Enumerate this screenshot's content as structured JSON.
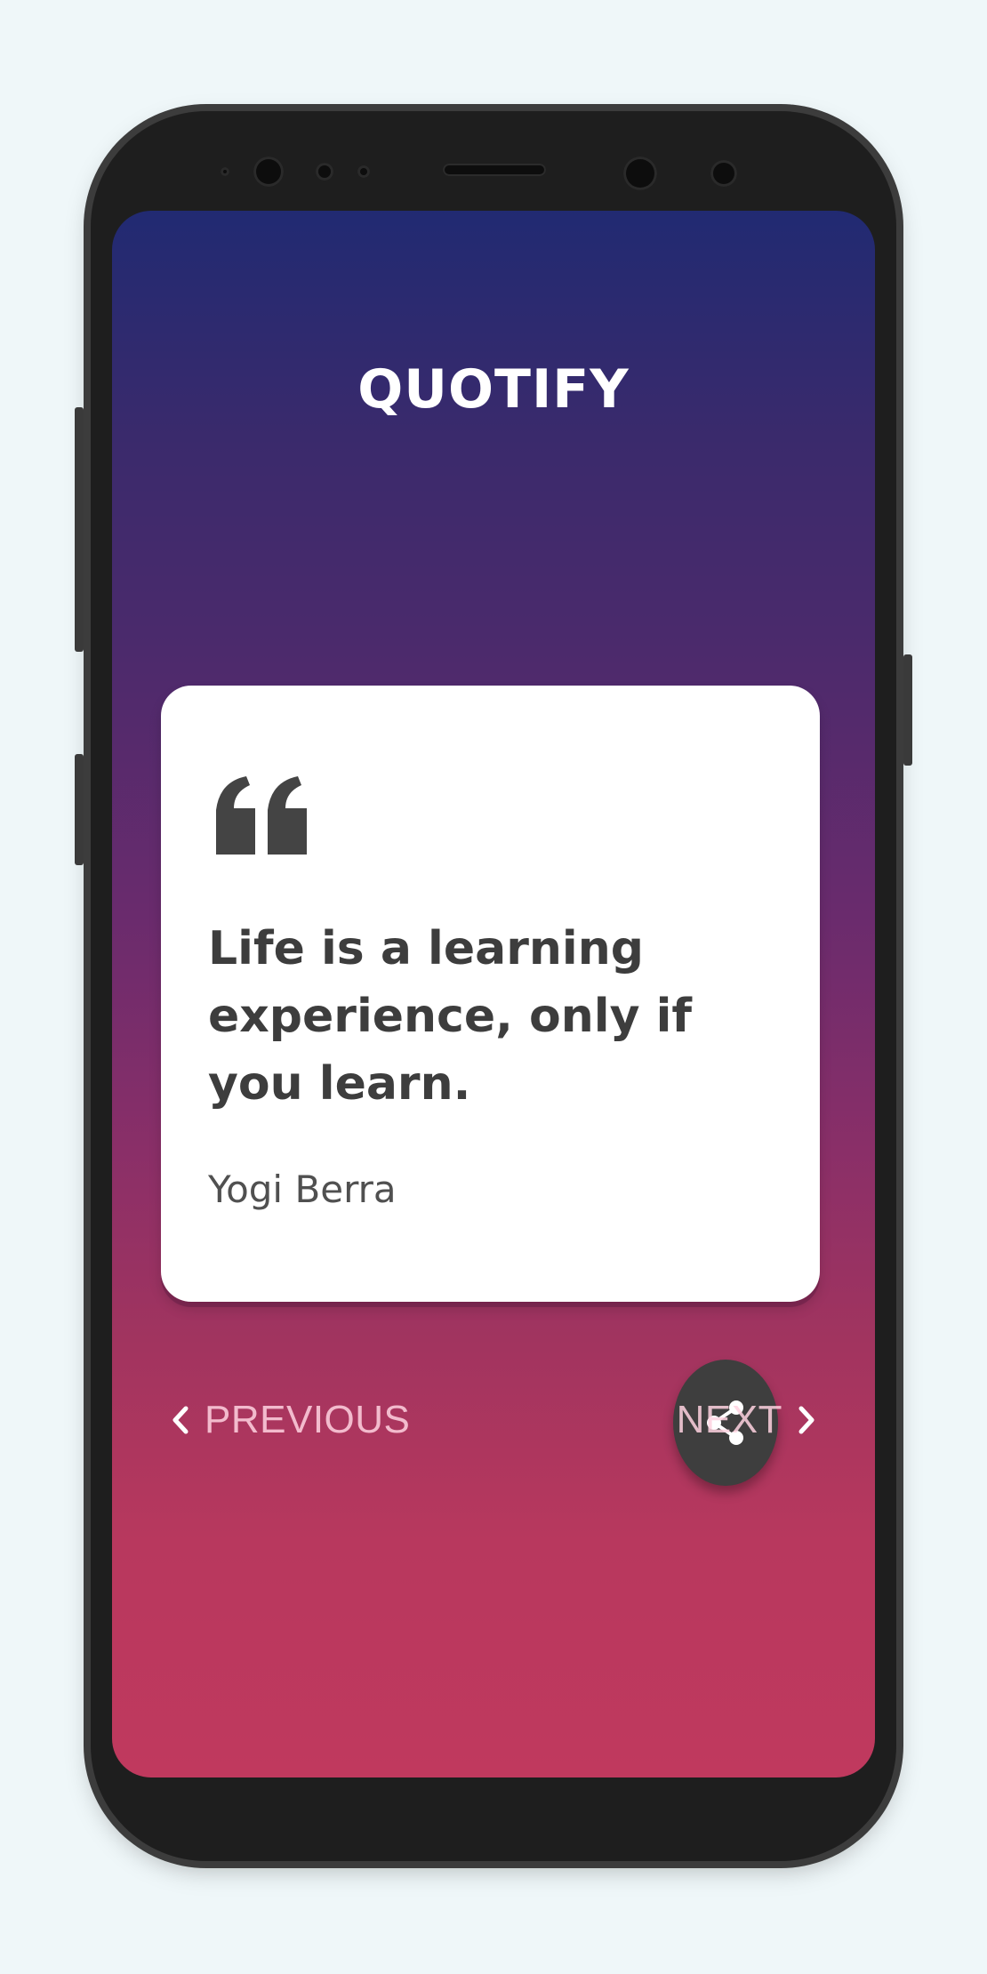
{
  "app": {
    "title": "QUOTIFY"
  },
  "quote": {
    "text": "Life is a learning experience, only if you learn.",
    "author": "Yogi Berra"
  },
  "navigation": {
    "previous_label": "PREVIOUS",
    "next_label": "NEXT"
  },
  "icons": {
    "quote_mark": "quote-mark-icon",
    "share": "share-icon",
    "previous": "chevron-left-icon",
    "next": "chevron-right-icon"
  },
  "colors": {
    "page_background": "#eff7f9",
    "gradient_top": "#212a72",
    "gradient_bottom": "#c0395e",
    "card_background": "#ffffff",
    "quote_text": "#3d3d3d",
    "fab_background": "#3e3e3e",
    "nav_text": "#f2bfd1"
  }
}
